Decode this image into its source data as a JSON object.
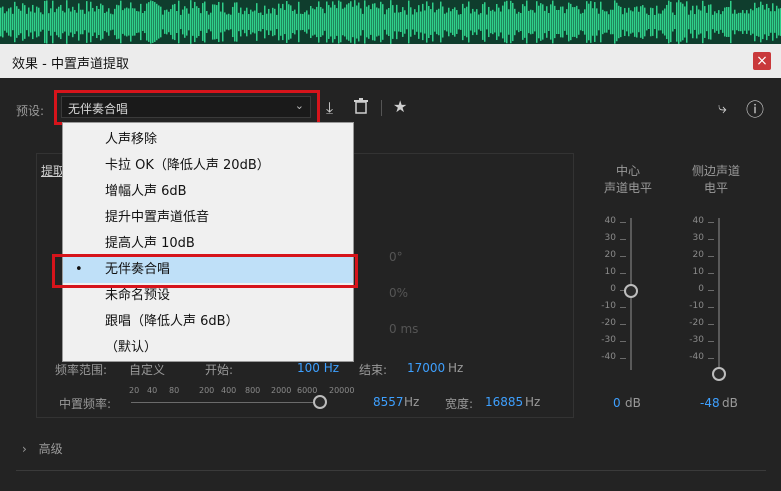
{
  "window": {
    "title": "效果 - 中置声道提取",
    "close_glyph": "×"
  },
  "toolbar": {
    "preset_label": "预设:",
    "preset_value": "无伴奏合唱",
    "icons": [
      "download-icon",
      "trash-icon",
      "star-icon",
      "routing-icon",
      "info-icon"
    ],
    "info_glyph": "ⓘ",
    "star_glyph": "★",
    "trash_glyph": "🗑",
    "save_glyph": "⤓",
    "route_glyph": "⤷"
  },
  "dropdown": {
    "items": [
      "人声移除",
      "卡拉 OK（降低人声 20dB）",
      "增幅人声 6dB",
      "提升中置声道低音",
      "提高人声 10dB",
      "无伴奏合唱",
      "未命名预设",
      "跟唱（降低人声 6dB）",
      "（默认）"
    ],
    "selected_index": 5,
    "selected_marker": "•"
  },
  "panel": {
    "tab_label": "提取",
    "faded_values": [
      "0°",
      "0%",
      "0 ms"
    ],
    "freq_range_label": "频率范围:",
    "freq_range_value": "自定义",
    "start_label": "开始:",
    "start_value": "100 Hz",
    "end_label": "结束:",
    "end_value": "17000",
    "end_unit": "Hz",
    "center_freq_label": "中置频率:",
    "scale_ticks": [
      "20",
      "40",
      "80",
      "200",
      "400",
      "800",
      "2000",
      "6000",
      "20000"
    ],
    "center_freq_value": "8557",
    "center_freq_unit": "Hz",
    "width_label": "宽度:",
    "width_value": "16885",
    "width_unit": "Hz"
  },
  "meters": {
    "center_title_1": "中心",
    "center_title_2": "声道电平",
    "side_title_1": "侧边声道",
    "side_title_2": "电平",
    "ticks": [
      "40",
      "30",
      "20",
      "10",
      "0",
      "-10",
      "-20",
      "-30",
      "-40"
    ],
    "center_value": "0",
    "center_unit": "dB",
    "side_value": "-48",
    "side_unit": "dB"
  },
  "advanced": {
    "label": "高级",
    "chevron": "›"
  }
}
